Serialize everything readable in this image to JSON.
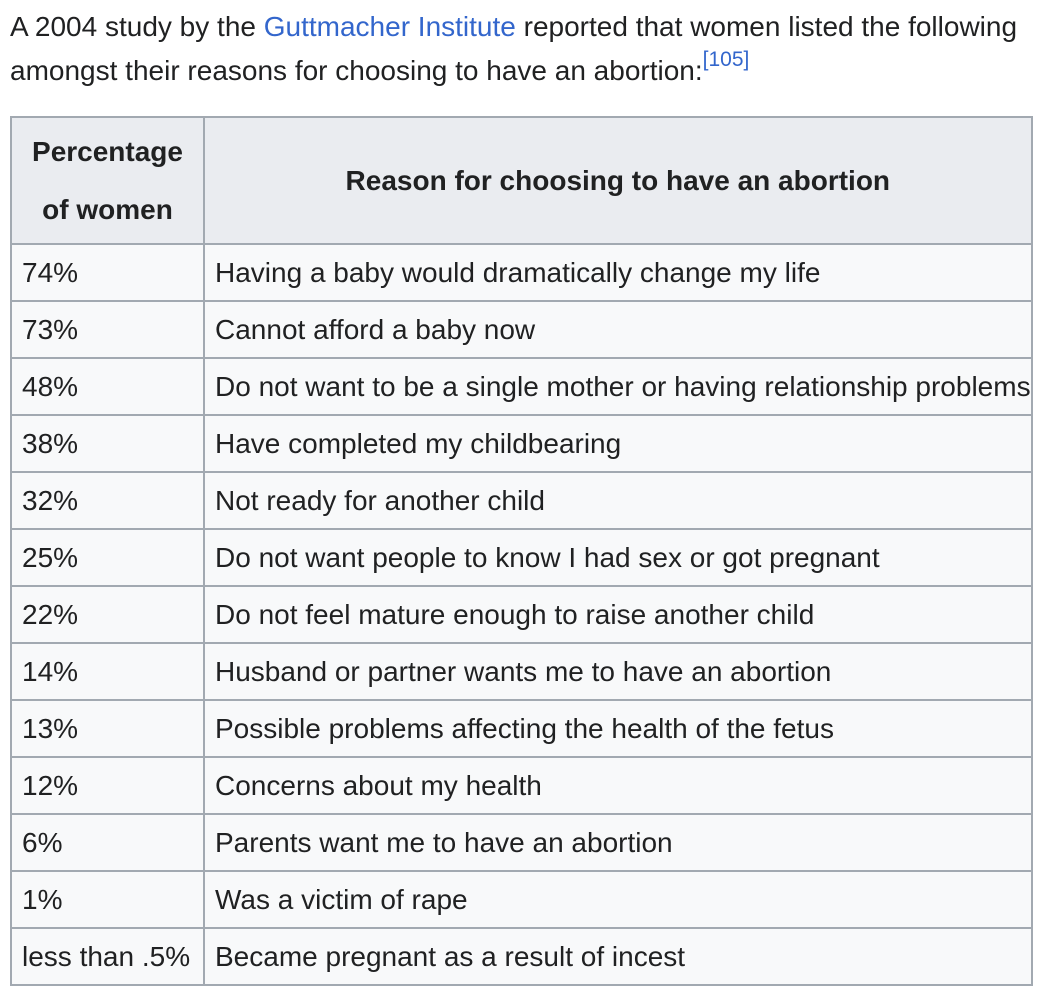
{
  "intro": {
    "text_before": "A 2004 study by the ",
    "link_text": "Guttmacher Institute",
    "text_after": " reported that women listed the following amongst their reasons for choosing to have an abortion:",
    "citation": "[105]"
  },
  "table": {
    "headers": {
      "percentage_line1": "Percentage",
      "percentage_line2": "of women",
      "reason": "Reason for choosing to have an abortion"
    },
    "rows": [
      {
        "percentage": "74%",
        "reason": "Having a baby would dramatically change my life"
      },
      {
        "percentage": "73%",
        "reason": "Cannot afford a baby now"
      },
      {
        "percentage": "48%",
        "reason": "Do not want to be a single mother or having relationship problems"
      },
      {
        "percentage": "38%",
        "reason": "Have completed my childbearing"
      },
      {
        "percentage": "32%",
        "reason": "Not ready for another child"
      },
      {
        "percentage": "25%",
        "reason": "Do not want people to know I had sex or got pregnant"
      },
      {
        "percentage": "22%",
        "reason": "Do not feel mature enough to raise another child"
      },
      {
        "percentage": "14%",
        "reason": "Husband or partner wants me to have an abortion"
      },
      {
        "percentage": "13%",
        "reason": "Possible problems affecting the health of the fetus"
      },
      {
        "percentage": "12%",
        "reason": "Concerns about my health"
      },
      {
        "percentage": "6%",
        "reason": "Parents want me to have an abortion"
      },
      {
        "percentage": "1%",
        "reason": "Was a victim of rape"
      },
      {
        "percentage": "less than .5%",
        "reason": "Became pregnant as a result of incest"
      }
    ]
  },
  "colors": {
    "link": "#3366cc",
    "text": "#202122",
    "header_bg": "#eaecf0",
    "cell_bg": "#f8f9fa",
    "border": "#a2a9b1"
  }
}
